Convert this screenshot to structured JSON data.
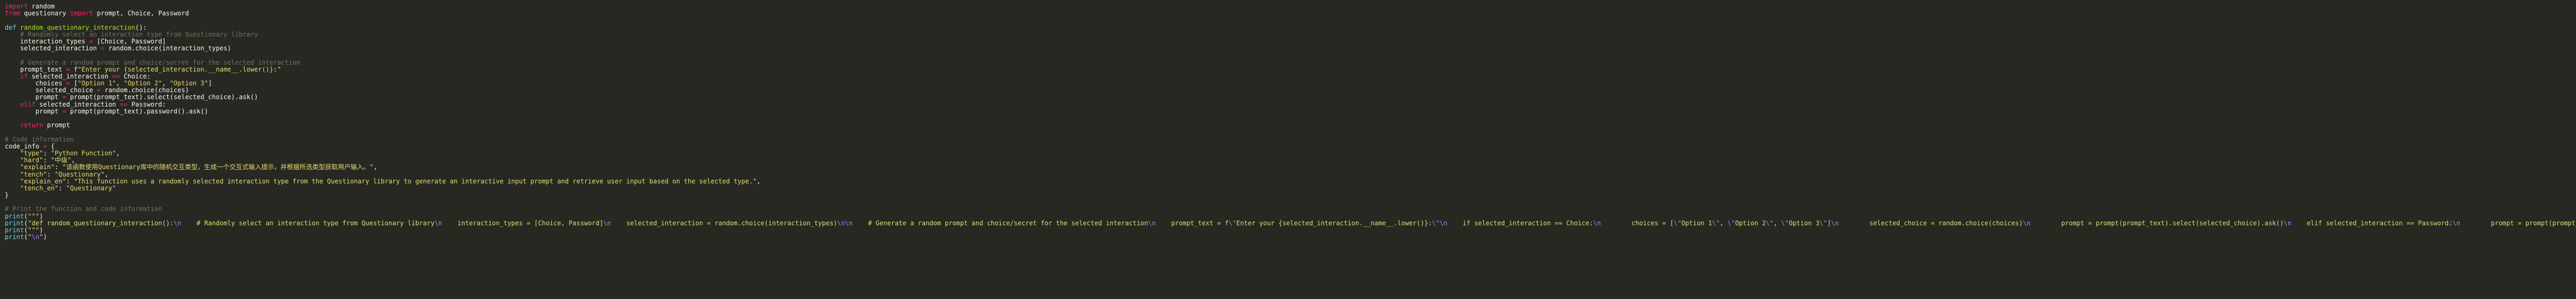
{
  "editor": {
    "lines": [
      [
        {
          "t": "k",
          "v": "import"
        },
        {
          "t": "",
          "v": " random"
        }
      ],
      [
        {
          "t": "k",
          "v": "from"
        },
        {
          "t": "",
          "v": " questionary "
        },
        {
          "t": "k",
          "v": "import"
        },
        {
          "t": "",
          "v": " prompt, Choice, Password"
        }
      ],
      [],
      [
        {
          "t": "p",
          "v": "def"
        },
        {
          "t": "",
          "v": " "
        },
        {
          "t": "f",
          "v": "random_questionary_interaction"
        },
        {
          "t": "",
          "v": "():"
        }
      ],
      [
        {
          "t": "",
          "v": "    "
        },
        {
          "t": "c",
          "v": "# Randomly select an interaction type from Questionary library"
        }
      ],
      [
        {
          "t": "",
          "v": "    interaction_types "
        },
        {
          "t": "k",
          "v": "="
        },
        {
          "t": "",
          "v": " [Choice, Password]"
        }
      ],
      [
        {
          "t": "",
          "v": "    selected_interaction "
        },
        {
          "t": "k",
          "v": "="
        },
        {
          "t": "",
          "v": " random.choice(interaction_types)"
        }
      ],
      [],
      [
        {
          "t": "",
          "v": "    "
        },
        {
          "t": "c",
          "v": "# Generate a random prompt and choice/secret for the selected interaction"
        }
      ],
      [
        {
          "t": "",
          "v": "    prompt_text "
        },
        {
          "t": "k",
          "v": "="
        },
        {
          "t": "",
          "v": " f"
        },
        {
          "t": "s",
          "v": "\"Enter your {selected_interaction.__name__.lower()}:\""
        }
      ],
      [
        {
          "t": "",
          "v": "    "
        },
        {
          "t": "k",
          "v": "if"
        },
        {
          "t": "",
          "v": " selected_interaction "
        },
        {
          "t": "k",
          "v": "=="
        },
        {
          "t": "",
          "v": " Choice:"
        }
      ],
      [
        {
          "t": "",
          "v": "        choices "
        },
        {
          "t": "k",
          "v": "="
        },
        {
          "t": "",
          "v": " ["
        },
        {
          "t": "s",
          "v": "\"Option 1\""
        },
        {
          "t": "",
          "v": ", "
        },
        {
          "t": "s",
          "v": "\"Option 2\""
        },
        {
          "t": "",
          "v": ", "
        },
        {
          "t": "s",
          "v": "\"Option 3\""
        },
        {
          "t": "",
          "v": "]"
        }
      ],
      [
        {
          "t": "",
          "v": "        selected_choice "
        },
        {
          "t": "k",
          "v": "="
        },
        {
          "t": "",
          "v": " random.choice(choices)"
        }
      ],
      [
        {
          "t": "",
          "v": "        prompt "
        },
        {
          "t": "k",
          "v": "="
        },
        {
          "t": "",
          "v": " prompt(prompt_text).select(selected_choice).ask()"
        }
      ],
      [
        {
          "t": "",
          "v": "    "
        },
        {
          "t": "k",
          "v": "elif"
        },
        {
          "t": "",
          "v": " selected_interaction "
        },
        {
          "t": "k",
          "v": "=="
        },
        {
          "t": "",
          "v": " Password:"
        }
      ],
      [
        {
          "t": "",
          "v": "        prompt "
        },
        {
          "t": "k",
          "v": "="
        },
        {
          "t": "",
          "v": " prompt(prompt_text).password().ask()"
        }
      ],
      [],
      [
        {
          "t": "",
          "v": "    "
        },
        {
          "t": "k",
          "v": "return"
        },
        {
          "t": "",
          "v": " prompt"
        }
      ],
      [],
      [
        {
          "t": "c",
          "v": "# Code information"
        }
      ],
      [
        {
          "t": "",
          "v": "code_info "
        },
        {
          "t": "k",
          "v": "="
        },
        {
          "t": "",
          "v": " {"
        }
      ],
      [
        {
          "t": "",
          "v": "    "
        },
        {
          "t": "s",
          "v": "\"type\""
        },
        {
          "t": "",
          "v": ": "
        },
        {
          "t": "s",
          "v": "\"Python Function\""
        },
        {
          "t": "",
          "v": ","
        }
      ],
      [
        {
          "t": "",
          "v": "    "
        },
        {
          "t": "s",
          "v": "\"hard\""
        },
        {
          "t": "",
          "v": ": "
        },
        {
          "t": "s",
          "v": "\"中级\""
        },
        {
          "t": "",
          "v": ","
        }
      ],
      [
        {
          "t": "",
          "v": "    "
        },
        {
          "t": "s",
          "v": "\"explain\""
        },
        {
          "t": "",
          "v": ": "
        },
        {
          "t": "s",
          "v": "\"该函数使用Questionary库中的随机交互类型，生成一个交互式输入提示，并根据所选类型获取用户输入。\""
        },
        {
          "t": "",
          "v": ","
        }
      ],
      [
        {
          "t": "",
          "v": "    "
        },
        {
          "t": "s",
          "v": "\"tench\""
        },
        {
          "t": "",
          "v": ": "
        },
        {
          "t": "s",
          "v": "\"Questionary\""
        },
        {
          "t": "",
          "v": ","
        }
      ],
      [
        {
          "t": "",
          "v": "    "
        },
        {
          "t": "s",
          "v": "\"explain_en\""
        },
        {
          "t": "",
          "v": ": "
        },
        {
          "t": "s",
          "v": "\"This function uses a randomly selected interaction type from the Questionary library to generate an interactive input prompt and retrieve user input based on the selected type.\""
        },
        {
          "t": "",
          "v": ","
        }
      ],
      [
        {
          "t": "",
          "v": "    "
        },
        {
          "t": "s",
          "v": "\"tench_en\""
        },
        {
          "t": "",
          "v": ": "
        },
        {
          "t": "s",
          "v": "\"Questionary\""
        }
      ],
      [
        {
          "t": "",
          "v": "}"
        }
      ],
      [],
      [
        {
          "t": "c",
          "v": "# Print the function and code information"
        }
      ],
      [
        {
          "t": "p",
          "v": "print"
        },
        {
          "t": "",
          "v": "("
        },
        {
          "t": "s",
          "v": "\"\"\""
        },
        {
          "t": "",
          "v": ")"
        }
      ],
      [
        {
          "t": "p",
          "v": "print"
        },
        {
          "t": "",
          "v": "("
        },
        {
          "t": "s",
          "v": "\"def random_questionary_interaction():"
        },
        {
          "t": "e",
          "v": "\\n"
        },
        {
          "t": "s",
          "v": "    # Randomly select an interaction type from Questionary library"
        },
        {
          "t": "e",
          "v": "\\n"
        },
        {
          "t": "s",
          "v": "    interaction_types = [Choice, Password]"
        },
        {
          "t": "e",
          "v": "\\n"
        },
        {
          "t": "s",
          "v": "    selected_interaction = random.choice(interaction_types)"
        },
        {
          "t": "e",
          "v": "\\n\\n"
        },
        {
          "t": "s",
          "v": "    # Generate a random prompt and choice/secret for the selected interaction"
        },
        {
          "t": "e",
          "v": "\\n"
        },
        {
          "t": "s",
          "v": "    prompt_text = f"
        },
        {
          "t": "e",
          "v": "\\\""
        },
        {
          "t": "s",
          "v": "Enter your {selected_interaction.__name__.lower()}:"
        },
        {
          "t": "e",
          "v": "\\\"\\n"
        },
        {
          "t": "s",
          "v": "    if selected_interaction == Choice:"
        },
        {
          "t": "e",
          "v": "\\n"
        },
        {
          "t": "s",
          "v": "        choices = ["
        },
        {
          "t": "e",
          "v": "\\\""
        },
        {
          "t": "s",
          "v": "Option 1"
        },
        {
          "t": "e",
          "v": "\\\""
        },
        {
          "t": "s",
          "v": ", "
        },
        {
          "t": "e",
          "v": "\\\""
        },
        {
          "t": "s",
          "v": "Option 2"
        },
        {
          "t": "e",
          "v": "\\\""
        },
        {
          "t": "s",
          "v": ", "
        },
        {
          "t": "e",
          "v": "\\\""
        },
        {
          "t": "s",
          "v": "Option 3"
        },
        {
          "t": "e",
          "v": "\\\""
        },
        {
          "t": "s",
          "v": "]"
        },
        {
          "t": "e",
          "v": "\\n"
        },
        {
          "t": "s",
          "v": "        selected_choice = random.choice(choices)"
        },
        {
          "t": "e",
          "v": "\\n"
        },
        {
          "t": "s",
          "v": "        prompt = prompt(prompt_text).select(selected_choice).ask()"
        },
        {
          "t": "e",
          "v": "\\n"
        },
        {
          "t": "s",
          "v": "    elif selected_interaction == Password:"
        },
        {
          "t": "e",
          "v": "\\n"
        },
        {
          "t": "s",
          "v": "        prompt = prompt(prompt_text).password().ask()"
        },
        {
          "t": "e",
          "v": "\\n\\n"
        },
        {
          "t": "s",
          "v": "    return prompt\""
        },
        {
          "t": "",
          "v": ")"
        }
      ],
      [
        {
          "t": "p",
          "v": "print"
        },
        {
          "t": "",
          "v": "("
        },
        {
          "t": "s",
          "v": "\"\"\""
        },
        {
          "t": "",
          "v": ")"
        }
      ],
      [
        {
          "t": "p",
          "v": "print"
        },
        {
          "t": "",
          "v": "("
        },
        {
          "t": "s",
          "v": "\""
        },
        {
          "t": "e",
          "v": "\\n"
        },
        {
          "t": "s",
          "v": "\""
        },
        {
          "t": "",
          "v": ")"
        }
      ]
    ]
  },
  "colors": {
    "background": "#272822",
    "keyword": "#f92672",
    "function_name": "#a6e22e",
    "string": "#e6db74",
    "comment": "#75715e",
    "escape": "#ae81ff",
    "builtin": "#66d9ef",
    "text": "#f8f8f2"
  }
}
